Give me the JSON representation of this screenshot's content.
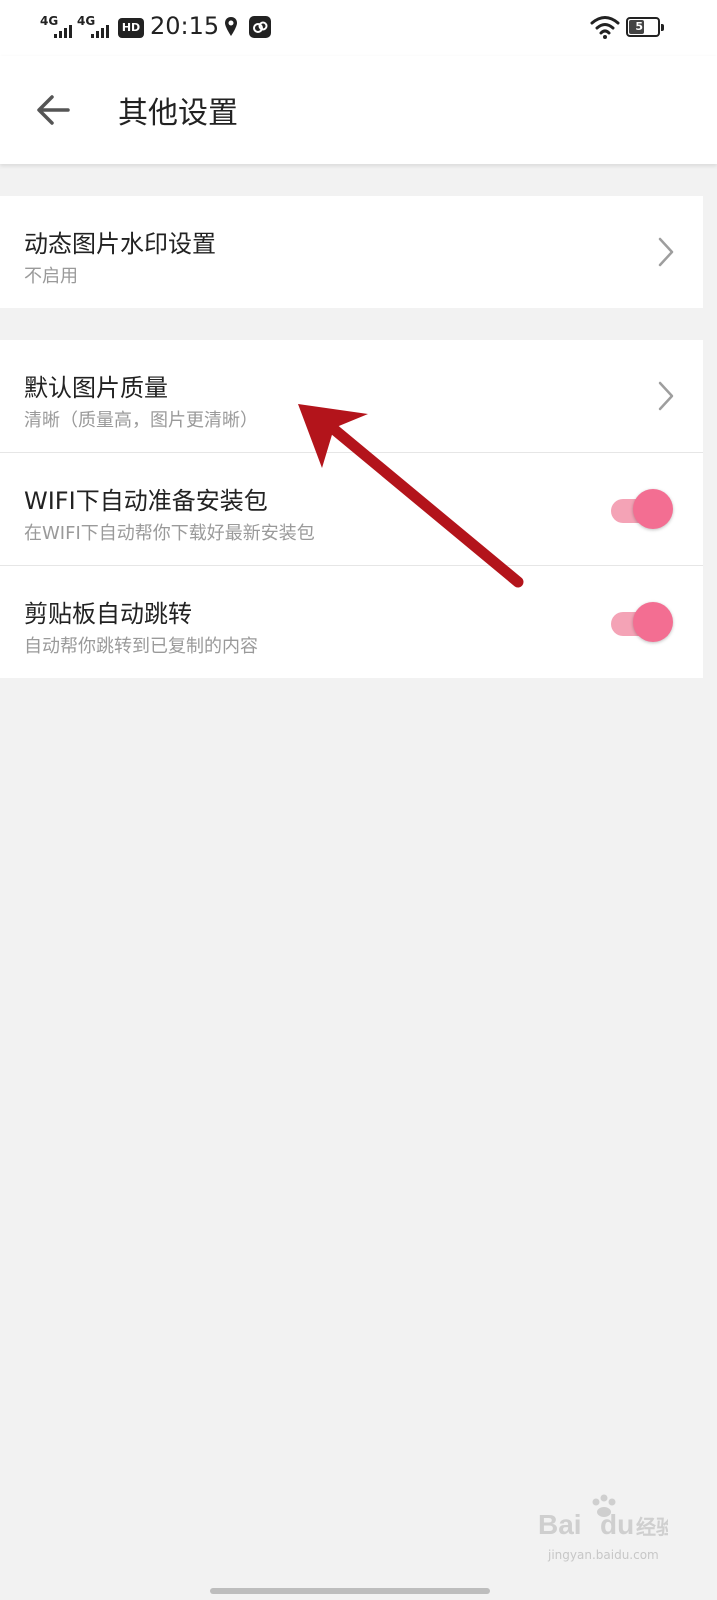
{
  "status": {
    "network_1": "4G",
    "network_2": "4G",
    "hd": "HD",
    "time": "20:15",
    "battery": "51"
  },
  "appbar": {
    "title": "其他设置"
  },
  "settings": {
    "group1": [
      {
        "label": "动态图片水印设置",
        "sub": "不启用",
        "control": "chevron"
      }
    ],
    "group2": [
      {
        "label": "默认图片质量",
        "sub": "清晰（质量高，图片更清晰）",
        "control": "chevron"
      },
      {
        "label": "WIFI下自动准备安装包",
        "sub": "在WIFI下自动帮你下载好最新安装包",
        "control": "toggle",
        "checked": true
      },
      {
        "label": "剪贴板自动跳转",
        "sub": "自动帮你跳转到已复制的内容",
        "control": "toggle",
        "checked": true
      }
    ]
  },
  "watermark": {
    "url": "jingyan.baidu.com"
  },
  "colors": {
    "accent": "#f36e92",
    "accent_track": "#f4a3b6",
    "annotation_arrow": "#b3141b",
    "background": "#f2f2f2"
  }
}
